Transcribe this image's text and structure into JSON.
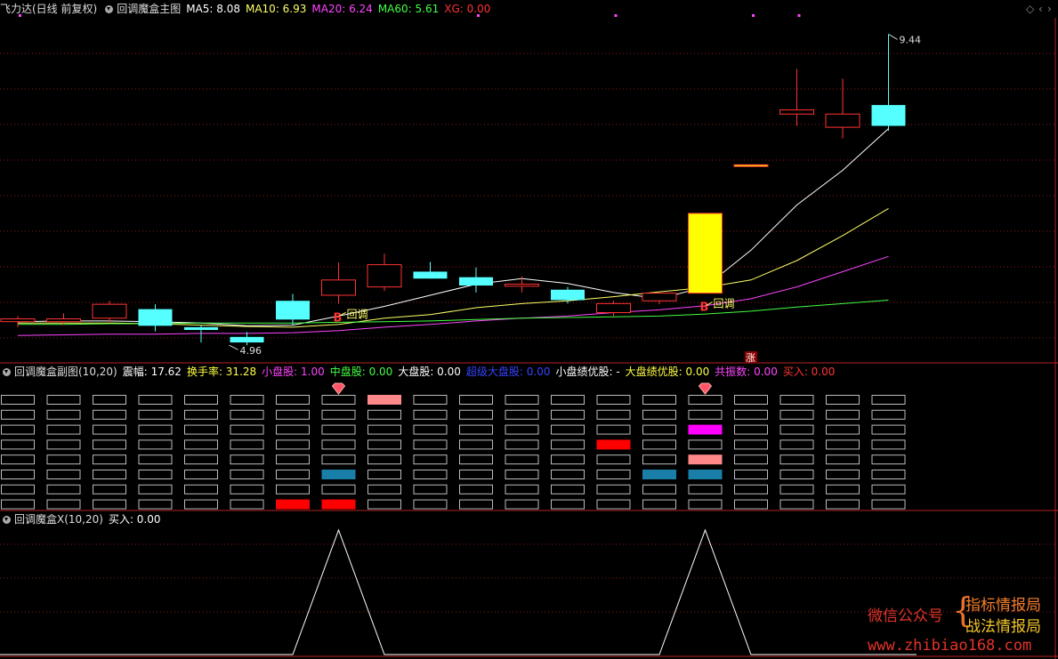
{
  "main": {
    "title": "飞力达(日线 前复权)",
    "indicator": "回调魔盒主图",
    "ma": [
      {
        "label": "MA5: 8.08",
        "color": "#ffffff"
      },
      {
        "label": "MA10: 6.93",
        "color": "#ffff66"
      },
      {
        "label": "MA20: 6.24",
        "color": "#ff44ff"
      },
      {
        "label": "MA60: 5.61",
        "color": "#44ff44"
      },
      {
        "label": "XG: 0.00",
        "color": "#ff3333"
      }
    ],
    "high_label": "9.44",
    "low_label": "4.96",
    "b_label": "B",
    "pullback_label": "回调",
    "limit_up_label": "涨"
  },
  "corner_icons": [
    "diamond-icon",
    "chevron-left-icon",
    "chevron-right-icon"
  ],
  "sub1": {
    "indicator": "回调魔盒副图(10,20)",
    "fields": [
      {
        "label": "震幅: 17.62",
        "color": "#ffffff"
      },
      {
        "label": "换手率: 31.28",
        "color": "#ffff44"
      },
      {
        "label": "小盘股: 1.00",
        "color": "#ff44ff"
      },
      {
        "label": "中盘股: 0.00",
        "color": "#44ff44"
      },
      {
        "label": "大盘股: 0.00",
        "color": "#ffffff"
      },
      {
        "label": "超级大盘股: 0.00",
        "color": "#3344ff"
      },
      {
        "label": "小盘绩优股: -",
        "color": "#ffffff"
      },
      {
        "label": "大盘绩优股: 0.00",
        "color": "#ffff44"
      },
      {
        "label": "共振数: 0.00",
        "color": "#ff44ff"
      },
      {
        "label": "买入: 0.00",
        "color": "#ff3333"
      }
    ],
    "gem_icon": "gem-icon"
  },
  "sub2": {
    "indicator": "回调魔盒X(10,20)",
    "fields": [
      {
        "label": "买入: 0.00",
        "color": "#ffffff"
      }
    ]
  },
  "watermark": {
    "wechat": "微信公众号",
    "brand1": "指标情报局",
    "brand2": "战法情报局",
    "url": "www.zhibiao168.com"
  },
  "colors": {
    "up": "#ff3333",
    "down": "#55ffff",
    "limit_up": "#ffff00",
    "grid": "#8b1a1a"
  },
  "chart_data": {
    "type": "candlestick",
    "price_range": [
      4.96,
      9.44
    ],
    "candles": [
      {
        "o": 5.3,
        "h": 5.38,
        "l": 5.22,
        "c": 5.34,
        "color": "up"
      },
      {
        "o": 5.3,
        "h": 5.42,
        "l": 5.25,
        "c": 5.34,
        "color": "up"
      },
      {
        "o": 5.35,
        "h": 5.6,
        "l": 5.28,
        "c": 5.55,
        "color": "up"
      },
      {
        "o": 5.48,
        "h": 5.55,
        "l": 5.16,
        "c": 5.24,
        "color": "down"
      },
      {
        "o": 5.22,
        "h": 5.25,
        "l": 5.0,
        "c": 5.18,
        "color": "down"
      },
      {
        "o": 5.08,
        "h": 5.15,
        "l": 4.96,
        "c": 5.0,
        "color": "down"
      },
      {
        "o": 5.6,
        "h": 5.7,
        "l": 5.25,
        "c": 5.33,
        "color": "down"
      },
      {
        "o": 5.68,
        "h": 6.15,
        "l": 5.56,
        "c": 5.9,
        "color": "up"
      },
      {
        "o": 5.8,
        "h": 6.28,
        "l": 5.74,
        "c": 6.12,
        "color": "up"
      },
      {
        "o": 6.02,
        "h": 6.16,
        "l": 5.92,
        "c": 5.92,
        "color": "down"
      },
      {
        "o": 5.94,
        "h": 6.08,
        "l": 5.72,
        "c": 5.82,
        "color": "down"
      },
      {
        "o": 5.81,
        "h": 5.95,
        "l": 5.72,
        "c": 5.84,
        "color": "up"
      },
      {
        "o": 5.76,
        "h": 5.8,
        "l": 5.56,
        "c": 5.61,
        "color": "down"
      },
      {
        "o": 5.43,
        "h": 5.6,
        "l": 5.38,
        "c": 5.56,
        "color": "up"
      },
      {
        "o": 5.6,
        "h": 5.72,
        "l": 5.55,
        "c": 5.71,
        "color": "up"
      },
      {
        "o": 5.71,
        "h": 6.86,
        "l": 5.71,
        "c": 6.86,
        "color": "limit_up"
      },
      {
        "o": 7.56,
        "h": 7.56,
        "l": 7.54,
        "c": 7.54,
        "color": "limit_up"
      },
      {
        "o": 8.29,
        "h": 8.94,
        "l": 8.12,
        "c": 8.35,
        "color": "up"
      },
      {
        "o": 8.1,
        "h": 8.8,
        "l": 7.94,
        "c": 8.29,
        "color": "up"
      },
      {
        "o": 8.42,
        "h": 9.44,
        "l": 8.05,
        "c": 8.12,
        "color": "down"
      }
    ],
    "series": [
      {
        "name": "MA5",
        "values": [
          5.3,
          5.31,
          5.31,
          5.3,
          5.28,
          5.24,
          5.25,
          5.38,
          5.52,
          5.68,
          5.84,
          5.92,
          5.85,
          5.72,
          5.63,
          5.8,
          6.33,
          6.98,
          7.48,
          8.08
        ]
      },
      {
        "name": "MA10",
        "values": [
          5.28,
          5.28,
          5.28,
          5.27,
          5.25,
          5.23,
          5.22,
          5.26,
          5.35,
          5.4,
          5.5,
          5.56,
          5.6,
          5.66,
          5.73,
          5.79,
          5.9,
          6.18,
          6.54,
          6.93
        ]
      },
      {
        "name": "MA20",
        "values": [
          5.1,
          5.11,
          5.12,
          5.12,
          5.13,
          5.13,
          5.14,
          5.17,
          5.22,
          5.26,
          5.31,
          5.35,
          5.38,
          5.43,
          5.47,
          5.53,
          5.63,
          5.8,
          6.02,
          6.24
        ]
      },
      {
        "name": "MA60",
        "values": [
          5.26,
          5.26,
          5.27,
          5.27,
          5.28,
          5.28,
          5.28,
          5.29,
          5.3,
          5.31,
          5.33,
          5.35,
          5.36,
          5.37,
          5.38,
          5.41,
          5.45,
          5.51,
          5.56,
          5.61
        ]
      }
    ],
    "b_signals": [
      7,
      15
    ],
    "box_grid": {
      "rows": 8,
      "filled": [
        {
          "col": 8,
          "row": 0,
          "color": "#ff8888"
        },
        {
          "col": 13,
          "row": 3,
          "color": "#ff0000"
        },
        {
          "col": 15,
          "row": 2,
          "color": "#ff00ff"
        },
        {
          "col": 15,
          "row": 4,
          "color": "#ff8888"
        },
        {
          "col": 7,
          "row": 5,
          "color": "#1a7fa8"
        },
        {
          "col": 14,
          "row": 5,
          "color": "#1a7fa8"
        },
        {
          "col": 15,
          "row": 5,
          "color": "#1a7fa8"
        },
        {
          "col": 6,
          "row": 7,
          "color": "#ff0000"
        },
        {
          "col": 7,
          "row": 7,
          "color": "#ff0000"
        }
      ]
    },
    "x_signal": [
      0,
      0,
      0,
      0,
      0,
      0,
      0,
      1,
      0,
      0,
      0,
      0,
      0,
      0,
      0,
      1,
      0,
      0,
      0,
      0
    ]
  }
}
